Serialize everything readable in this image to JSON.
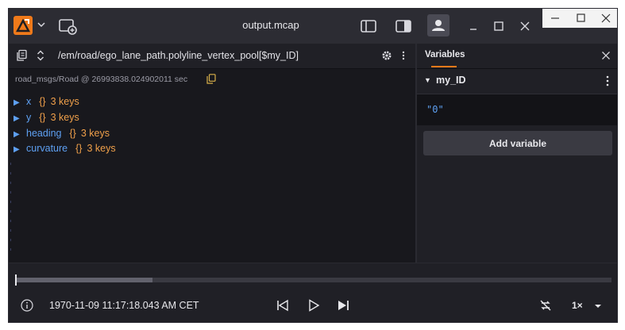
{
  "window": {
    "title": "output.mcap"
  },
  "path_bar": {
    "path": "/em/road/ego_lane_path.polyline_vertex_pool[$my_ID]"
  },
  "message": {
    "source": "road_msgs/Road @ 26993838.024902011 sec",
    "fields": [
      {
        "key": "x",
        "brace": "{}",
        "count": "3 keys"
      },
      {
        "key": "y",
        "brace": "{}",
        "count": "3 keys"
      },
      {
        "key": "heading",
        "brace": "{}",
        "count": "3 keys"
      },
      {
        "key": "curvature",
        "brace": "{}",
        "count": "3 keys"
      }
    ]
  },
  "variables_panel": {
    "title": "Variables",
    "variable": {
      "name": "my_ID",
      "value": "\"0\""
    },
    "add_button": "Add variable"
  },
  "playback": {
    "timestamp": "1970-11-09 11:17:18.043 AM CET",
    "speed": "1×",
    "progress": 0.23
  },
  "colors": {
    "accent": "#f07a1a",
    "key_blue": "#5ea0f2",
    "value_orange": "#f0a04a"
  },
  "icons": [
    "app-logo-icon",
    "chevron-down-icon",
    "new-window-icon",
    "layout-left-icon",
    "layout-right-icon",
    "user-icon",
    "minimize-icon",
    "maximize-icon",
    "close-icon",
    "copy-icon",
    "sort-icon",
    "gear-icon",
    "more-vertical-icon",
    "info-icon",
    "skip-back-icon",
    "play-icon",
    "skip-forward-icon",
    "loop-off-icon"
  ]
}
